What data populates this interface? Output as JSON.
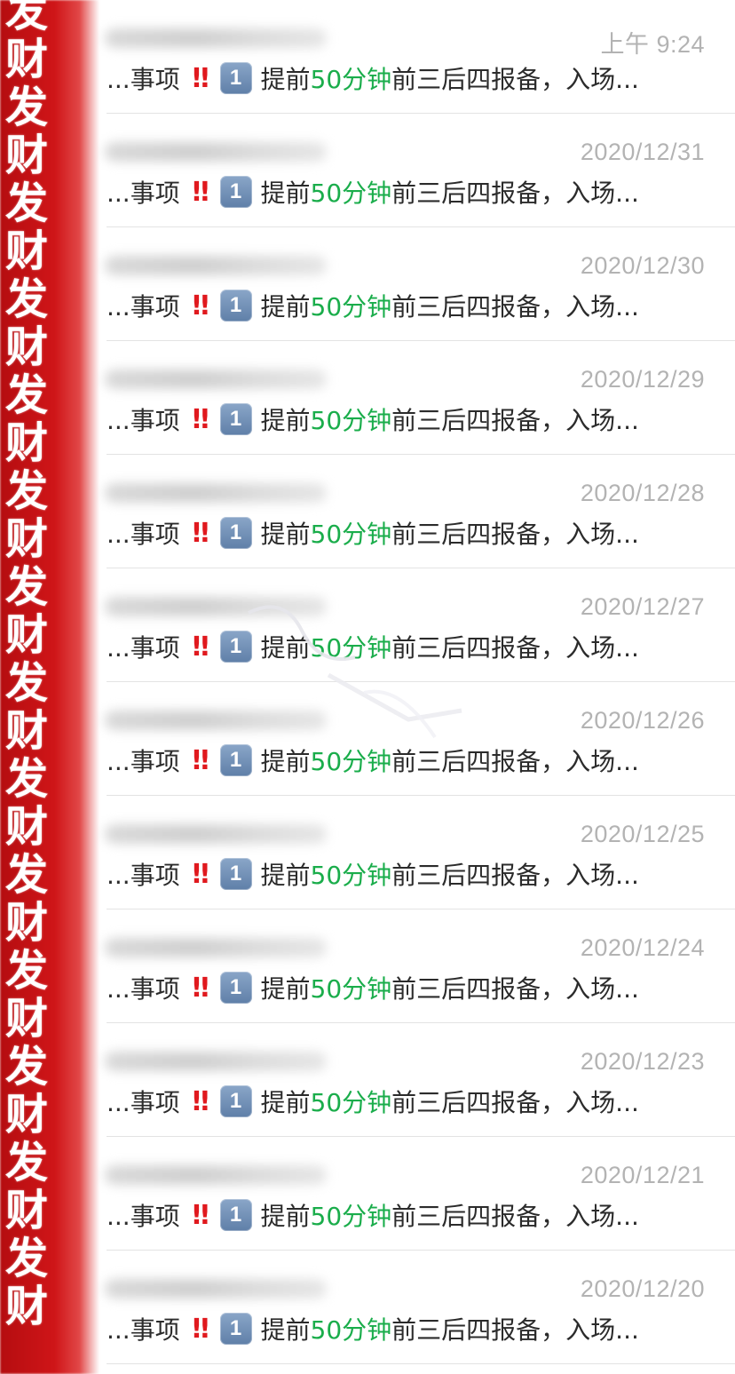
{
  "censor": {
    "text": "发财发财发财发财发财发财发财发财发财发财发财发财发财发财",
    "color": "#cf1518"
  },
  "colors": {
    "highlight_green": "#1aad4b",
    "exclamation_red": "#e0191e",
    "badge_blue": "#6d8db5",
    "time_gray": "#b3b3b3"
  },
  "conversations": [
    {
      "time": "上午 9:24",
      "preview_prefix": "...事项",
      "exclamation": "‼",
      "badge": "1",
      "pre": "提前",
      "highlight": "50分钟",
      "rest": "前三后四报备，入场..."
    },
    {
      "time": "2020/12/31",
      "preview_prefix": "...事项",
      "exclamation": "‼",
      "badge": "1",
      "pre": "提前",
      "highlight": "50分钟",
      "rest": "前三后四报备，入场..."
    },
    {
      "time": "2020/12/30",
      "preview_prefix": "...事项",
      "exclamation": "‼",
      "badge": "1",
      "pre": "提前",
      "highlight": "50分钟",
      "rest": "前三后四报备，入场..."
    },
    {
      "time": "2020/12/29",
      "preview_prefix": "...事项",
      "exclamation": "‼",
      "badge": "1",
      "pre": "提前",
      "highlight": "50分钟",
      "rest": "前三后四报备，入场..."
    },
    {
      "time": "2020/12/28",
      "preview_prefix": "...事项",
      "exclamation": "‼",
      "badge": "1",
      "pre": "提前",
      "highlight": "50分钟",
      "rest": "前三后四报备，入场..."
    },
    {
      "time": "2020/12/27",
      "preview_prefix": "...事项",
      "exclamation": "‼",
      "badge": "1",
      "pre": "提前",
      "highlight": "50分钟",
      "rest": "前三后四报备，入场..."
    },
    {
      "time": "2020/12/26",
      "preview_prefix": "...事项",
      "exclamation": "‼",
      "badge": "1",
      "pre": "提前",
      "highlight": "50分钟",
      "rest": "前三后四报备，入场..."
    },
    {
      "time": "2020/12/25",
      "preview_prefix": "...事项",
      "exclamation": "‼",
      "badge": "1",
      "pre": "提前",
      "highlight": "50分钟",
      "rest": "前三后四报备，入场..."
    },
    {
      "time": "2020/12/24",
      "preview_prefix": "...事项",
      "exclamation": "‼",
      "badge": "1",
      "pre": "提前",
      "highlight": "50分钟",
      "rest": "前三后四报备，入场..."
    },
    {
      "time": "2020/12/23",
      "preview_prefix": "...事项",
      "exclamation": "‼",
      "badge": "1",
      "pre": "提前",
      "highlight": "50分钟",
      "rest": "前三后四报备，入场..."
    },
    {
      "time": "2020/12/21",
      "preview_prefix": "...事项",
      "exclamation": "‼",
      "badge": "1",
      "pre": "提前",
      "highlight": "50分钟",
      "rest": "前三后四报备，入场..."
    },
    {
      "time": "2020/12/20",
      "preview_prefix": "...事项",
      "exclamation": "‼",
      "badge": "1",
      "pre": "提前",
      "highlight": "50分钟",
      "rest": "前三后四报备，入场..."
    }
  ]
}
